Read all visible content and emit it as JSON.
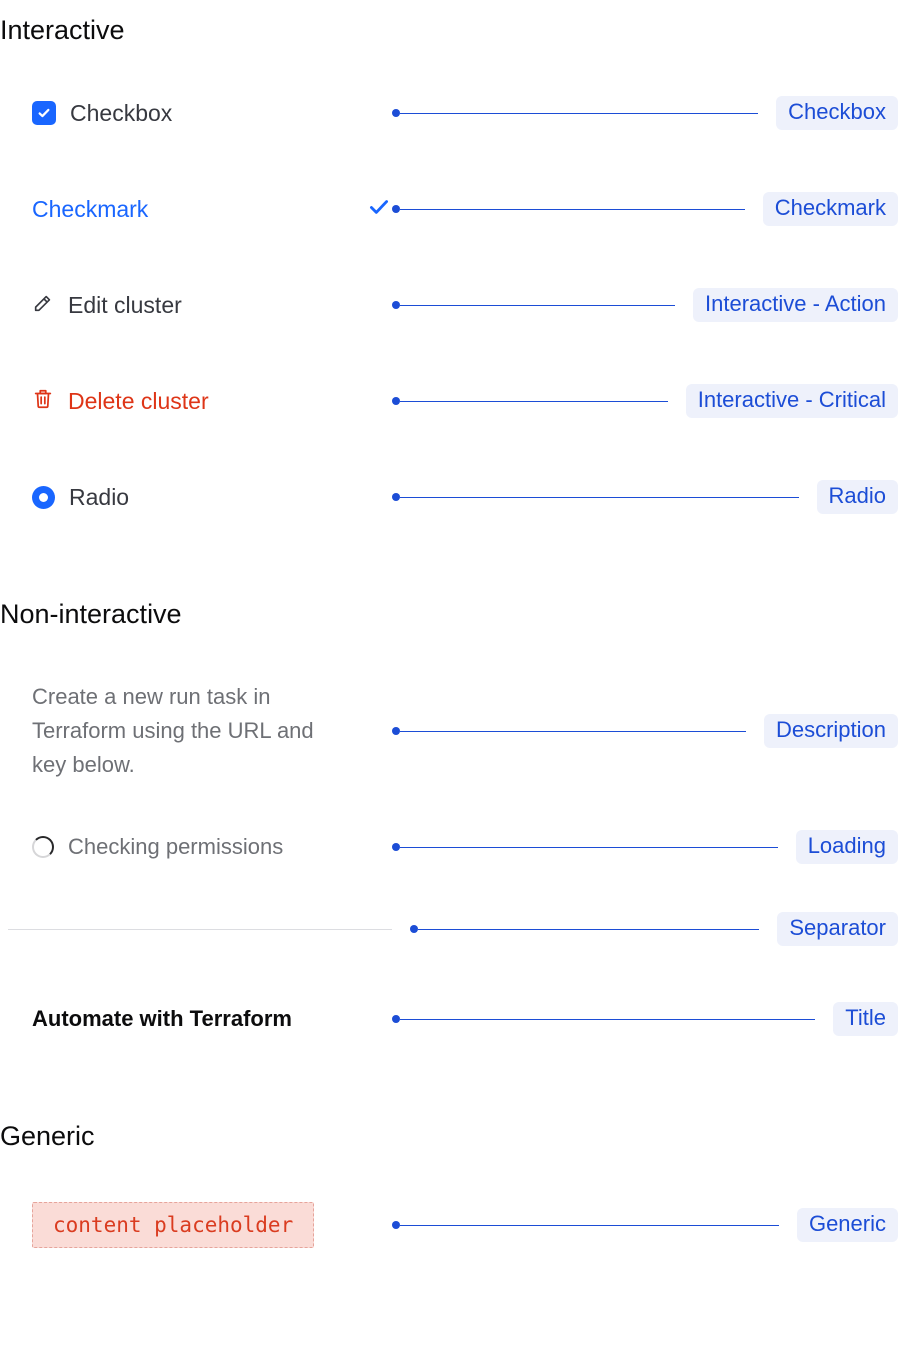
{
  "sections": {
    "interactive": {
      "title": "Interactive",
      "items": {
        "checkbox": {
          "label": "Checkbox",
          "badge": "Checkbox"
        },
        "checkmark": {
          "label": "Checkmark",
          "badge": "Checkmark"
        },
        "edit": {
          "label": "Edit cluster",
          "badge": "Interactive - Action"
        },
        "delete": {
          "label": "Delete cluster",
          "badge": "Interactive - Critical"
        },
        "radio": {
          "label": "Radio",
          "badge": "Radio"
        }
      }
    },
    "noninteractive": {
      "title": "Non-interactive",
      "items": {
        "description": {
          "text": "Create a new run task in Terraform using the URL and key below.",
          "badge": "Description"
        },
        "loading": {
          "label": "Checking permissions",
          "badge": "Loading"
        },
        "separator": {
          "badge": "Separator"
        },
        "title_item": {
          "label": "Automate with Terraform",
          "badge": "Title"
        }
      }
    },
    "generic": {
      "title": "Generic",
      "items": {
        "placeholder": {
          "label": "content placeholder",
          "badge": "Generic"
        }
      }
    }
  }
}
